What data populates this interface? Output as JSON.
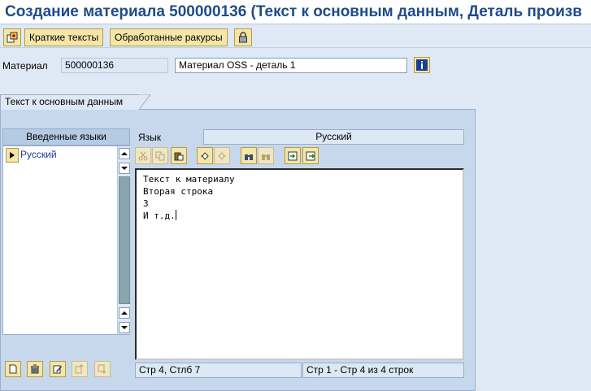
{
  "title": "Создание материала 500000136 (Текст к основным данным, Деталь произв",
  "appbar": {
    "other_object_icon": "other-object-icon",
    "short_texts_label": "Краткие тексты",
    "processed_views_label": "Обработанные ракурсы",
    "lock_icon": "lock-icon"
  },
  "header": {
    "material_label": "Материал",
    "material_number": "500000136",
    "material_description": "Материал OSS - деталь 1",
    "info_icon": "info-icon"
  },
  "tab": {
    "label": "Текст к основным данным"
  },
  "languages": {
    "header": "Введенные языки",
    "items": [
      "Русский"
    ]
  },
  "text_editor": {
    "language_label": "Язык",
    "language_value": "Русский",
    "toolbar_icons": [
      "cut-icon",
      "copy-icon",
      "paste-icon",
      "undo-icon",
      "redo-icon",
      "find-icon",
      "find-next-icon",
      "import-icon",
      "export-icon"
    ],
    "lines": [
      "Текст к материалу",
      "Вторая строка",
      "3",
      "И т.д."
    ],
    "status_position": "Стр 4, Стлб 7",
    "status_lines": "Стр 1 - Стр 4 из 4 строк"
  },
  "bottom_toolbar": {
    "icons": [
      "new-document-icon",
      "delete-icon",
      "edit-icon",
      "move-up-icon",
      "move-down-icon"
    ]
  },
  "colors": {
    "title_text": "#1f4b8a",
    "background": "#dfe9f5",
    "button": "#f4e6a9",
    "panel": "#c7d8ec"
  }
}
